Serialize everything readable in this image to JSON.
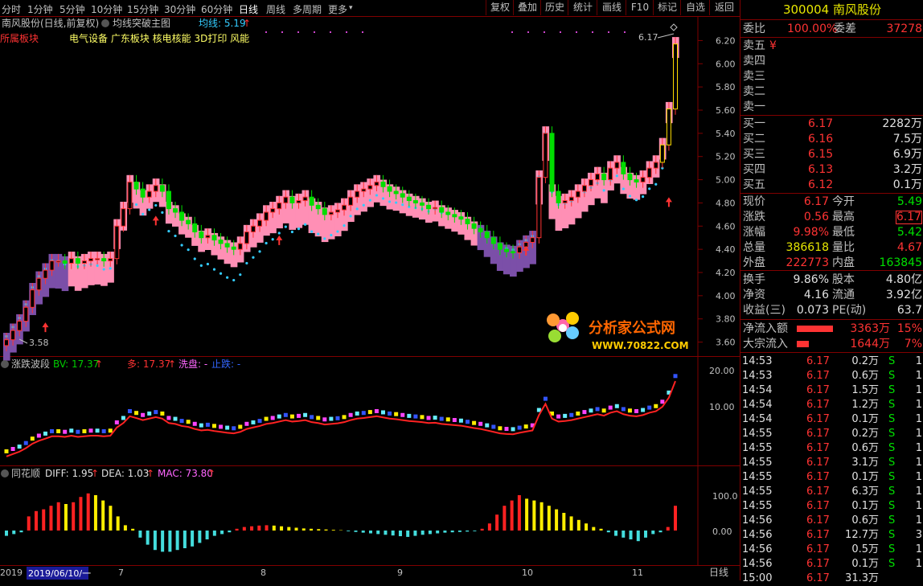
{
  "toolbar": {
    "periods": [
      "分时",
      "1分钟",
      "5分钟",
      "10分钟",
      "15分钟",
      "30分钟",
      "60分钟",
      "日线",
      "周线",
      "多周期",
      "更多"
    ],
    "active_period": "日线",
    "right_buttons": [
      "复权",
      "叠加",
      "历史",
      "统计",
      "画线",
      "F10",
      "标记",
      "自选",
      "返回"
    ]
  },
  "main": {
    "title": "南风股份(日线,前复权)",
    "indicator": "均线突破主图",
    "ma_label": "均线: 5.19",
    "sector_tag": "所属板块",
    "sectors": "电气设备 广东板块 核电核能 3D打印 风能",
    "high_label": "6.17",
    "low_label": "3.58",
    "price_ticks": [
      "6.20",
      "6.00",
      "5.80",
      "5.60",
      "5.40",
      "5.20",
      "5.00",
      "4.80",
      "4.60",
      "4.40",
      "4.20",
      "4.00",
      "3.80",
      "3.60"
    ],
    "watermark": "分析家公式网",
    "watermark_url": "WWW.70822.COM"
  },
  "sub1": {
    "name": "涨跌波段",
    "bv": "BV: 17.37",
    "duo": "多: 17.37",
    "xipan": "洗盘: -",
    "zhidie": "止跌: -",
    "ticks": [
      "20.00",
      "10.00"
    ]
  },
  "sub2": {
    "name": "同花顺",
    "diff": "DIFF: 1.95",
    "dea": "DEA: 1.03",
    "mac": "MAC: 73.80",
    "ticks": [
      "100.0",
      "0.00"
    ]
  },
  "xaxis": {
    "year": "2019",
    "date_cursor": "2019/06/10/一",
    "months": [
      "7",
      "8",
      "9",
      "10",
      "11"
    ],
    "period": "日线"
  },
  "quote": {
    "code": "300004",
    "name": "南风股份",
    "weibi_label": "委比",
    "weibi": "100.00%",
    "weicha_label": "委差",
    "weicha": "37278",
    "sells": [
      {
        "label": "卖五",
        "price": "¥",
        "vol": ""
      },
      {
        "label": "卖四",
        "price": "",
        "vol": ""
      },
      {
        "label": "卖三",
        "price": "",
        "vol": ""
      },
      {
        "label": "卖二",
        "price": "",
        "vol": ""
      },
      {
        "label": "卖一",
        "price": "",
        "vol": ""
      }
    ],
    "buys": [
      {
        "label": "买一",
        "price": "6.17",
        "vol": "2282万"
      },
      {
        "label": "买二",
        "price": "6.16",
        "vol": "7.5万"
      },
      {
        "label": "买三",
        "price": "6.15",
        "vol": "6.9万"
      },
      {
        "label": "买四",
        "price": "6.13",
        "vol": "3.2万"
      },
      {
        "label": "买五",
        "price": "6.12",
        "vol": "0.1万"
      }
    ],
    "stats": [
      {
        "l1": "现价",
        "v1": "6.17",
        "c1": "red",
        "l2": "今开",
        "v2": "5.49",
        "c2": "green"
      },
      {
        "l1": "涨跌",
        "v1": "0.56",
        "c1": "red",
        "l2": "最高",
        "v2": "6.17",
        "c2": "red"
      },
      {
        "l1": "涨幅",
        "v1": "9.98%",
        "c1": "red",
        "l2": "最低",
        "v2": "5.42",
        "c2": "green"
      },
      {
        "l1": "总量",
        "v1": "386618",
        "c1": "yellow",
        "l2": "量比",
        "v2": "4.67",
        "c2": "red"
      },
      {
        "l1": "外盘",
        "v1": "222773",
        "c1": "red",
        "l2": "内盘",
        "v2": "163845",
        "c2": "green"
      }
    ],
    "stats2": [
      {
        "l1": "换手",
        "v1": "9.86%",
        "l2": "股本",
        "v2": "4.80亿"
      },
      {
        "l1": "净资",
        "v1": "4.16",
        "l2": "流通",
        "v2": "3.92亿"
      },
      {
        "l1": "收益(三)",
        "v1": "0.073",
        "l2": "PE(动)",
        "v2": "63.7"
      }
    ],
    "flows": [
      {
        "label": "净流入额",
        "value": "3363万",
        "pct": "15%",
        "bar": 0.9
      },
      {
        "label": "大宗流入",
        "value": "1644万",
        "pct": "7%",
        "bar": 0.3
      }
    ]
  },
  "ticks": [
    {
      "t": "14:53",
      "p": "6.17",
      "v": "0.2万",
      "s": "S",
      "n": "1"
    },
    {
      "t": "14:53",
      "p": "6.17",
      "v": "0.6万",
      "s": "S",
      "n": "1"
    },
    {
      "t": "14:54",
      "p": "6.17",
      "v": "1.5万",
      "s": "S",
      "n": "1"
    },
    {
      "t": "14:54",
      "p": "6.17",
      "v": "1.2万",
      "s": "S",
      "n": "1"
    },
    {
      "t": "14:54",
      "p": "6.17",
      "v": "0.1万",
      "s": "S",
      "n": "1"
    },
    {
      "t": "14:55",
      "p": "6.17",
      "v": "0.2万",
      "s": "S",
      "n": "1"
    },
    {
      "t": "14:55",
      "p": "6.17",
      "v": "0.6万",
      "s": "S",
      "n": "1"
    },
    {
      "t": "14:55",
      "p": "6.17",
      "v": "3.1万",
      "s": "S",
      "n": "1"
    },
    {
      "t": "14:55",
      "p": "6.17",
      "v": "0.1万",
      "s": "S",
      "n": "1"
    },
    {
      "t": "14:55",
      "p": "6.17",
      "v": "6.3万",
      "s": "S",
      "n": "1"
    },
    {
      "t": "14:55",
      "p": "6.17",
      "v": "0.1万",
      "s": "S",
      "n": "1"
    },
    {
      "t": "14:56",
      "p": "6.17",
      "v": "0.6万",
      "s": "S",
      "n": "1"
    },
    {
      "t": "14:56",
      "p": "6.17",
      "v": "12.7万",
      "s": "S",
      "n": "3"
    },
    {
      "t": "14:56",
      "p": "6.17",
      "v": "0.5万",
      "s": "S",
      "n": "1"
    },
    {
      "t": "14:56",
      "p": "6.17",
      "v": "0.1万",
      "s": "S",
      "n": "1"
    },
    {
      "t": "15:00",
      "p": "6.17",
      "v": "31.3万",
      "s": "",
      "n": ""
    }
  ],
  "chart_data": {
    "type": "candlestick",
    "title": "南风股份(日线,前复权)",
    "ylim": [
      3.5,
      6.3
    ],
    "close": [
      3.62,
      3.7,
      3.78,
      3.9,
      4.05,
      4.15,
      4.22,
      4.3,
      4.3,
      4.28,
      4.32,
      4.28,
      4.3,
      4.32,
      4.32,
      4.3,
      4.32,
      4.6,
      4.75,
      4.98,
      4.92,
      4.85,
      4.9,
      4.95,
      4.9,
      4.75,
      4.72,
      4.65,
      4.62,
      4.55,
      4.5,
      4.52,
      4.48,
      4.45,
      4.42,
      4.4,
      4.45,
      4.55,
      4.6,
      4.65,
      4.72,
      4.75,
      4.8,
      4.85,
      4.8,
      4.82,
      4.85,
      4.78,
      4.75,
      4.7,
      4.72,
      4.74,
      4.78,
      4.85,
      4.9,
      4.92,
      4.95,
      4.98,
      4.94,
      4.9,
      4.88,
      4.85,
      4.82,
      4.8,
      4.78,
      4.75,
      4.76,
      4.72,
      4.7,
      4.68,
      4.66,
      4.62,
      4.58,
      4.55,
      4.5,
      4.45,
      4.4,
      4.38,
      4.37,
      4.42,
      4.46,
      4.5,
      5.02,
      5.4,
      4.9,
      4.8,
      4.82,
      4.85,
      4.9,
      4.95,
      5.0,
      5.05,
      5.0,
      5.1,
      5.15,
      5.05,
      5.0,
      4.98,
      5.02,
      5.1,
      5.15,
      5.3,
      5.61,
      6.17
    ],
    "macd": [
      -15,
      -10,
      -5,
      40,
      55,
      60,
      70,
      80,
      75,
      80,
      95,
      105,
      100,
      85,
      70,
      40,
      15,
      5,
      -20,
      -40,
      -55,
      -60,
      -60,
      -55,
      -50,
      -45,
      -35,
      -25,
      -15,
      -10,
      -5,
      5,
      10,
      12,
      14,
      15,
      14,
      12,
      10,
      8,
      6,
      5,
      4,
      3,
      2,
      1,
      -2,
      -4,
      -6,
      -8,
      -10,
      -12,
      -14,
      -16,
      -18,
      -15,
      -12,
      -10,
      -8,
      -6,
      -5,
      -4,
      -3,
      -2,
      5,
      20,
      45,
      70,
      85,
      100,
      90,
      85,
      80,
      70,
      60,
      50,
      40,
      30,
      20,
      10,
      5,
      -5,
      -15,
      -20,
      -25,
      -30,
      -20,
      -10,
      -5,
      10,
      70
    ]
  }
}
